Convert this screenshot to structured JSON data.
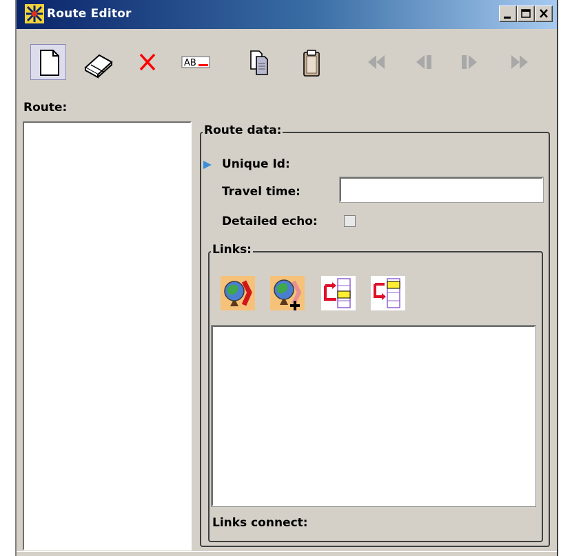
{
  "window": {
    "title": "Route Editor",
    "controls": {
      "minimize": "minimize",
      "maximize": "maximize",
      "close": "close"
    }
  },
  "toolbar": {
    "buttons": [
      {
        "name": "new",
        "icon": "new-document-icon"
      },
      {
        "name": "eraser",
        "icon": "eraser-icon"
      },
      {
        "name": "delete",
        "icon": "red-x-icon"
      },
      {
        "name": "rename",
        "icon": "rename-field-icon",
        "text": "AB"
      },
      {
        "name": "copy",
        "icon": "copy-icon"
      },
      {
        "name": "paste",
        "icon": "paste-icon"
      },
      {
        "name": "first",
        "icon": "rewind-icon",
        "disabled": true
      },
      {
        "name": "previous",
        "icon": "step-back-icon",
        "disabled": true
      },
      {
        "name": "next",
        "icon": "step-forward-icon",
        "disabled": true
      },
      {
        "name": "last",
        "icon": "fast-forward-icon",
        "disabled": true
      }
    ]
  },
  "route": {
    "label": "Route:"
  },
  "route_data": {
    "title": "Route data:",
    "unique_id_label": "Unique Id:",
    "travel_time_label": "Travel time:",
    "travel_time_value": "",
    "detailed_echo_label": "Detailed echo:",
    "detailed_echo_checked": false
  },
  "links": {
    "title": "Links:",
    "connect_label": "Links connect:",
    "buttons": [
      {
        "name": "remove-link",
        "icon": "globe-remove-icon"
      },
      {
        "name": "add-link",
        "icon": "globe-add-icon"
      },
      {
        "name": "link-before",
        "icon": "insert-before-icon"
      },
      {
        "name": "link-after",
        "icon": "insert-after-icon"
      }
    ]
  },
  "colors": {
    "titlebar_start": "#0a246a",
    "titlebar_end": "#a6caf0",
    "face": "#d4d0c8",
    "disabled_icon": "#a8a8a8",
    "delete_red": "#ff0000",
    "marker_blue": "#3b8fd6"
  }
}
